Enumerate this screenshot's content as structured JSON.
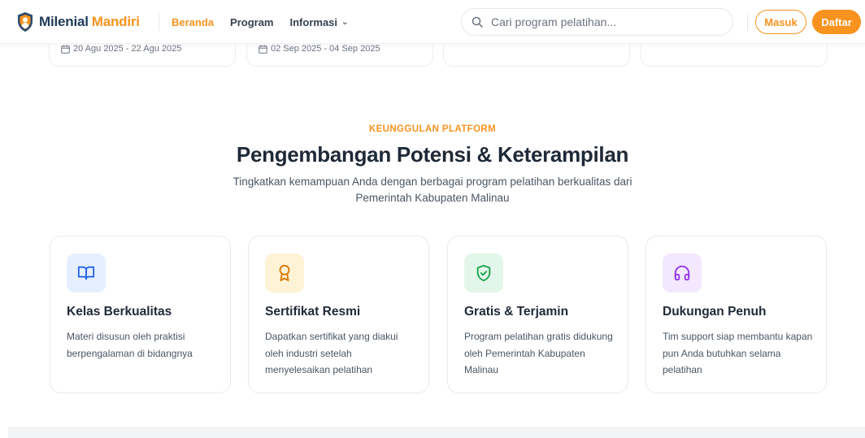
{
  "brand": {
    "name_part1": "Milenial",
    "name_part2": "Mandiri"
  },
  "nav": {
    "items": [
      {
        "label": "Beranda",
        "active": true
      },
      {
        "label": "Program",
        "active": false
      },
      {
        "label": "Informasi",
        "active": false,
        "dropdown": true
      }
    ]
  },
  "search": {
    "placeholder": "Cari program pelatihan..."
  },
  "auth": {
    "login_label": "Masuk",
    "register_label": "Daftar"
  },
  "top_cards": [
    {
      "date_range": "20 Agu 2025 - 22 Agu 2025"
    },
    {
      "date_range": "02 Sep 2025 - 04 Sep 2025"
    },
    {
      "date_range": ""
    },
    {
      "date_range": ""
    }
  ],
  "section": {
    "eyebrow": "KEUNGGULAN PLATFORM",
    "title": "Pengembangan Potensi & Keterampilan",
    "subtitle": "Tingkatkan kemampuan Anda dengan berbagai program pelatihan berkualitas dari Pemerintah Kabupaten Malinau"
  },
  "features": [
    {
      "icon": "book-open-icon",
      "title": "Kelas Berkualitas",
      "desc": "Materi disusun oleh praktisi berpengalaman di bidangnya"
    },
    {
      "icon": "award-icon",
      "title": "Sertifikat Resmi",
      "desc": "Dapatkan sertifikat yang diakui oleh industri setelah menyelesaikan pelatihan"
    },
    {
      "icon": "shield-check-icon",
      "title": "Gratis & Terjamin",
      "desc": "Program pelatihan gratis didukung oleh Pemerintah Kabupaten Malinau"
    },
    {
      "icon": "headphones-icon",
      "title": "Dukungan Penuh",
      "desc": "Tim support siap membantu kapan pun Anda butuhkan selama pelatihan"
    }
  ],
  "colors": {
    "accent": "#f7931e",
    "brand_dark": "#1f3a5a",
    "icon_bg_blue": "#e6efff",
    "icon_bg_yellow": "#fff3d6",
    "icon_bg_green": "#e3f6ea",
    "icon_bg_purple": "#f3e8ff"
  }
}
